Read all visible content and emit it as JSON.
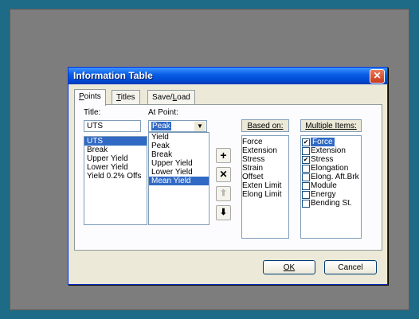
{
  "window": {
    "title": "Information Table",
    "close_glyph": "✕"
  },
  "tabs": [
    {
      "label": "Points",
      "key": "P",
      "rest": "oints"
    },
    {
      "label": "Titles",
      "key": "T",
      "rest": "itles"
    },
    {
      "label": "Save/Load",
      "pre": "Save/",
      "key": "L",
      "rest": "oad"
    }
  ],
  "title_field": {
    "label": "Title:",
    "value": "UTS"
  },
  "titles_list": [
    "UTS",
    "Break",
    "Upper Yield",
    "Lower Yield",
    "Yield 0.2% Offs"
  ],
  "titles_selected": 0,
  "at_point": {
    "label": "At Point:",
    "value": "Peak",
    "options": [
      "Yield",
      "Peak",
      "Break",
      "Upper Yield",
      "Lower Yield",
      "Mean Yield"
    ],
    "selected": 5
  },
  "side_buttons": {
    "add": "+",
    "remove": "✕",
    "up": "⬆",
    "down": "⬇"
  },
  "based_on": {
    "label": "Based on:",
    "items": [
      "Force",
      "Extension",
      "Stress",
      "Strain",
      "Offset",
      "Exten Limit",
      "Elong Limit"
    ]
  },
  "multiple_items": {
    "label": "Multiple Items:",
    "items": [
      {
        "label": "Force",
        "checked": true,
        "selected": true
      },
      {
        "label": "Extension",
        "checked": false
      },
      {
        "label": "Stress",
        "checked": true
      },
      {
        "label": "Elongation",
        "checked": false
      },
      {
        "label": "Elong. Aft.Brk",
        "checked": false
      },
      {
        "label": "Module",
        "checked": false
      },
      {
        "label": "Energy",
        "checked": false
      },
      {
        "label": "Bending St.",
        "checked": false
      }
    ]
  },
  "footer": {
    "ok": "OK",
    "cancel": "Cancel"
  }
}
